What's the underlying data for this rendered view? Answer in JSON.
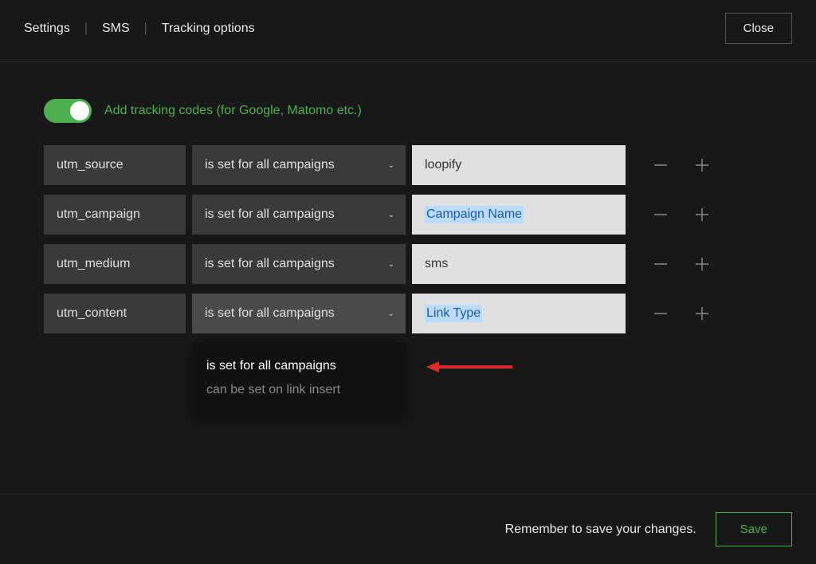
{
  "header": {
    "breadcrumb": [
      "Settings",
      "SMS",
      "Tracking options"
    ],
    "close_label": "Close"
  },
  "toggle": {
    "enabled": true,
    "label": "Add tracking codes (for Google, Matomo etc.)"
  },
  "rows": [
    {
      "param": "utm_source",
      "scope": "is set for all campaigns",
      "value": "loopify",
      "value_is_tag": false
    },
    {
      "param": "utm_campaign",
      "scope": "is set for all campaigns",
      "value": "Campaign Name",
      "value_is_tag": true
    },
    {
      "param": "utm_medium",
      "scope": "is set for all campaigns",
      "value": "sms",
      "value_is_tag": false
    },
    {
      "param": "utm_content",
      "scope": "is set for all campaigns",
      "value": "Link Type",
      "value_is_tag": true
    }
  ],
  "dropdown": {
    "open_on_row": 3,
    "options": [
      "is set for all campaigns",
      "can be set on link insert"
    ]
  },
  "footer": {
    "reminder": "Remember to save your changes.",
    "save_label": "Save"
  },
  "colors": {
    "accent": "#4caf50",
    "tag_bg": "#bcdcff",
    "tag_fg": "#1a5aad",
    "arrow": "#d92b2b"
  }
}
